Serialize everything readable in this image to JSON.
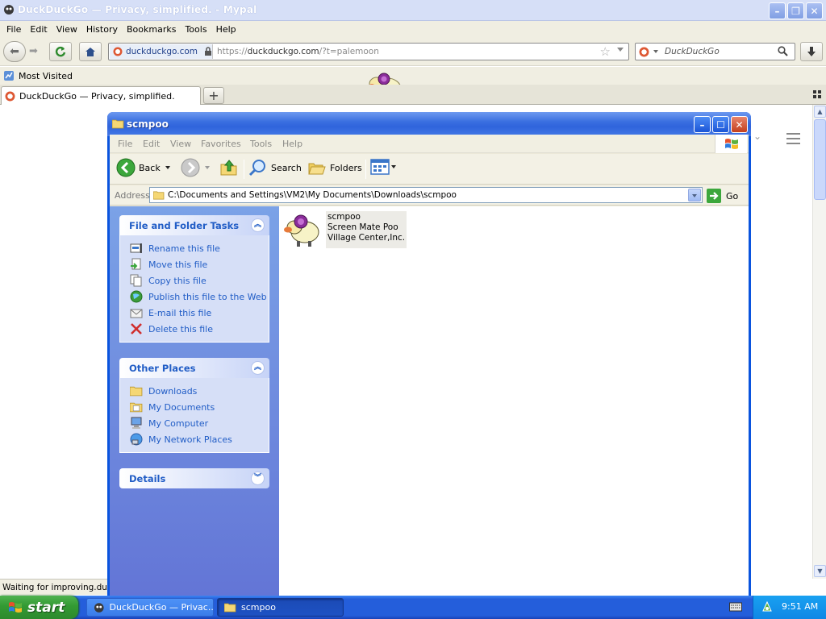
{
  "browser": {
    "title": "DuckDuckGo — Privacy, simplified. - Mypal",
    "menu": [
      "File",
      "Edit",
      "View",
      "History",
      "Bookmarks",
      "Tools",
      "Help"
    ],
    "url_identity": "duckduckgo.com",
    "url_prefix": "https://",
    "url_host": "duckduckgo.com",
    "url_path": "/?t=palemoon",
    "search_placeholder": "DuckDuckGo",
    "bookmark_most_visited": "Most Visited",
    "tab_title": "DuckDuckGo — Privacy, simplified.",
    "new_tab_symbol": "+",
    "status_text": "Waiting for improving.duck"
  },
  "explorer": {
    "title": "scmpoo",
    "menu": [
      "File",
      "Edit",
      "View",
      "Favorites",
      "Tools",
      "Help"
    ],
    "toolbar": {
      "back": "Back",
      "search": "Search",
      "folders": "Folders"
    },
    "address_label": "Address",
    "address_path": "C:\\Documents and Settings\\VM2\\My Documents\\Downloads\\scmpoo",
    "go_label": "Go",
    "file_folder_tasks": {
      "title": "File and Folder Tasks",
      "items": [
        "Rename this file",
        "Move this file",
        "Copy this file",
        "Publish this file to the Web",
        "E-mail this file",
        "Delete this file"
      ]
    },
    "other_places": {
      "title": "Other Places",
      "items": [
        "Downloads",
        "My Documents",
        "My Computer",
        "My Network Places"
      ]
    },
    "details": {
      "title": "Details"
    },
    "file": {
      "name": "scmpoo",
      "description": "Screen Mate Poo",
      "company": "Village Center,Inc."
    }
  },
  "taskbar": {
    "start_label": "start",
    "tasks": [
      "DuckDuckGo — Privac...",
      "scmpoo"
    ],
    "clock": "9:51 AM"
  },
  "colors": {
    "xp_blue": "#0a54de",
    "task_link": "#215dc6",
    "start_green": "#339a33"
  }
}
